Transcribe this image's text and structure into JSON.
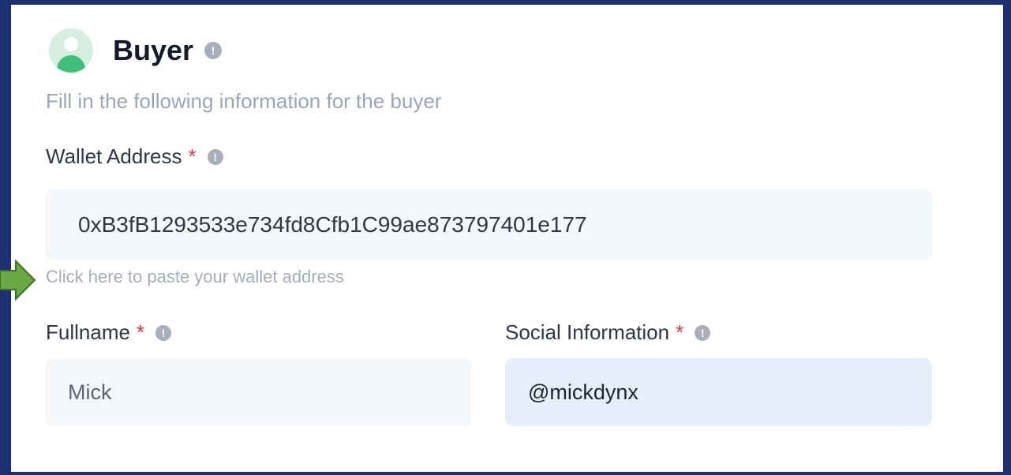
{
  "buyer": {
    "title": "Buyer",
    "subtitle": "Fill in the following information for the buyer"
  },
  "wallet": {
    "label": "Wallet Address",
    "required_mark": "*",
    "value": "0xB3fB1293533e734fd8Cfb1C99ae873797401e177",
    "paste_hint": "Click here to paste your wallet address"
  },
  "fullname": {
    "label": "Fullname",
    "required_mark": "*",
    "value": "Mick"
  },
  "social": {
    "label": "Social Information",
    "required_mark": "*",
    "value": "@mickdynx"
  },
  "icons": {
    "info": "!",
    "avatar": "user-avatar-icon",
    "annotation": "green-arrow-icon"
  },
  "colors": {
    "background": "#1d3170",
    "required": "#e0324a",
    "avatar_accent": "#3fbf7a",
    "arrow": "#6aa842"
  }
}
